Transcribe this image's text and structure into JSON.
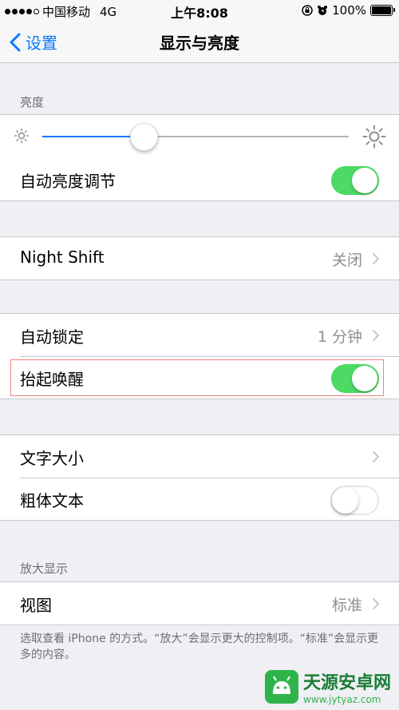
{
  "status": {
    "carrier": "中国移动",
    "network": "4G",
    "time": "上午8:08",
    "battery": "100%"
  },
  "nav": {
    "back_label": "设置",
    "title": "显示与亮度"
  },
  "brightness": {
    "header": "亮度",
    "level": 0.33
  },
  "auto_brightness": {
    "label": "自动亮度调节",
    "on": true
  },
  "night_shift": {
    "label": "Night Shift",
    "value": "关闭"
  },
  "auto_lock": {
    "label": "自动锁定",
    "value": "1 分钟"
  },
  "raise_to_wake": {
    "label": "抬起唤醒",
    "on": true
  },
  "text_size": {
    "label": "文字大小"
  },
  "bold_text": {
    "label": "粗体文本",
    "on": false
  },
  "zoom": {
    "header": "放大显示",
    "view_label": "视图",
    "view_value": "标准",
    "footnote": "选取查看 iPhone 的方式。“放大”会显示更大的控制项。“标准”会显示更多的内容。"
  },
  "watermark": {
    "name": "天源安卓网",
    "url": "www.jytyaz.com"
  },
  "colors": {
    "accent": "#0a7aff",
    "toggle_on": "#4cd964"
  }
}
